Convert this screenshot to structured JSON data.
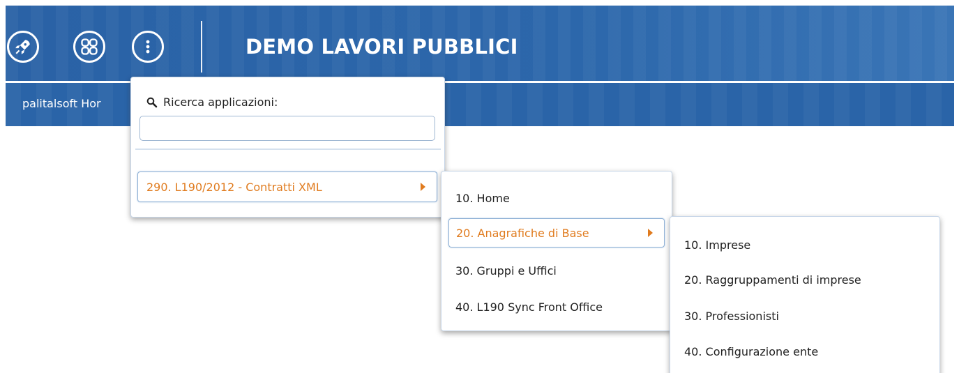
{
  "header": {
    "title": "DEMO LAVORI PUBBLICI",
    "icons": [
      "rocket-icon",
      "apps-grid-icon",
      "more-vertical-icon"
    ]
  },
  "subbar": {
    "text": "palitalsoft Hor"
  },
  "search": {
    "label": "Ricerca applicazioni:",
    "value": "",
    "placeholder": ""
  },
  "menu_level1": {
    "items": [
      {
        "label": "290. L190/2012 - Contratti XML",
        "active": true
      }
    ]
  },
  "menu_level2": {
    "items": [
      {
        "label": "10. Home"
      },
      {
        "label": "20. Anagrafiche di Base",
        "active": true
      },
      {
        "label": "30. Gruppi e Uffici"
      },
      {
        "label": "40. L190 Sync Front Office"
      }
    ]
  },
  "menu_level3": {
    "items": [
      {
        "label": "10. Imprese"
      },
      {
        "label": "20. Raggruppamenti di imprese"
      },
      {
        "label": "30. Professionisti"
      },
      {
        "label": "40. Configurazione ente"
      }
    ]
  },
  "colors": {
    "header_blue": "#2a64a8",
    "active_orange": "#e07b1e",
    "border_blue": "#8fb1d6"
  }
}
